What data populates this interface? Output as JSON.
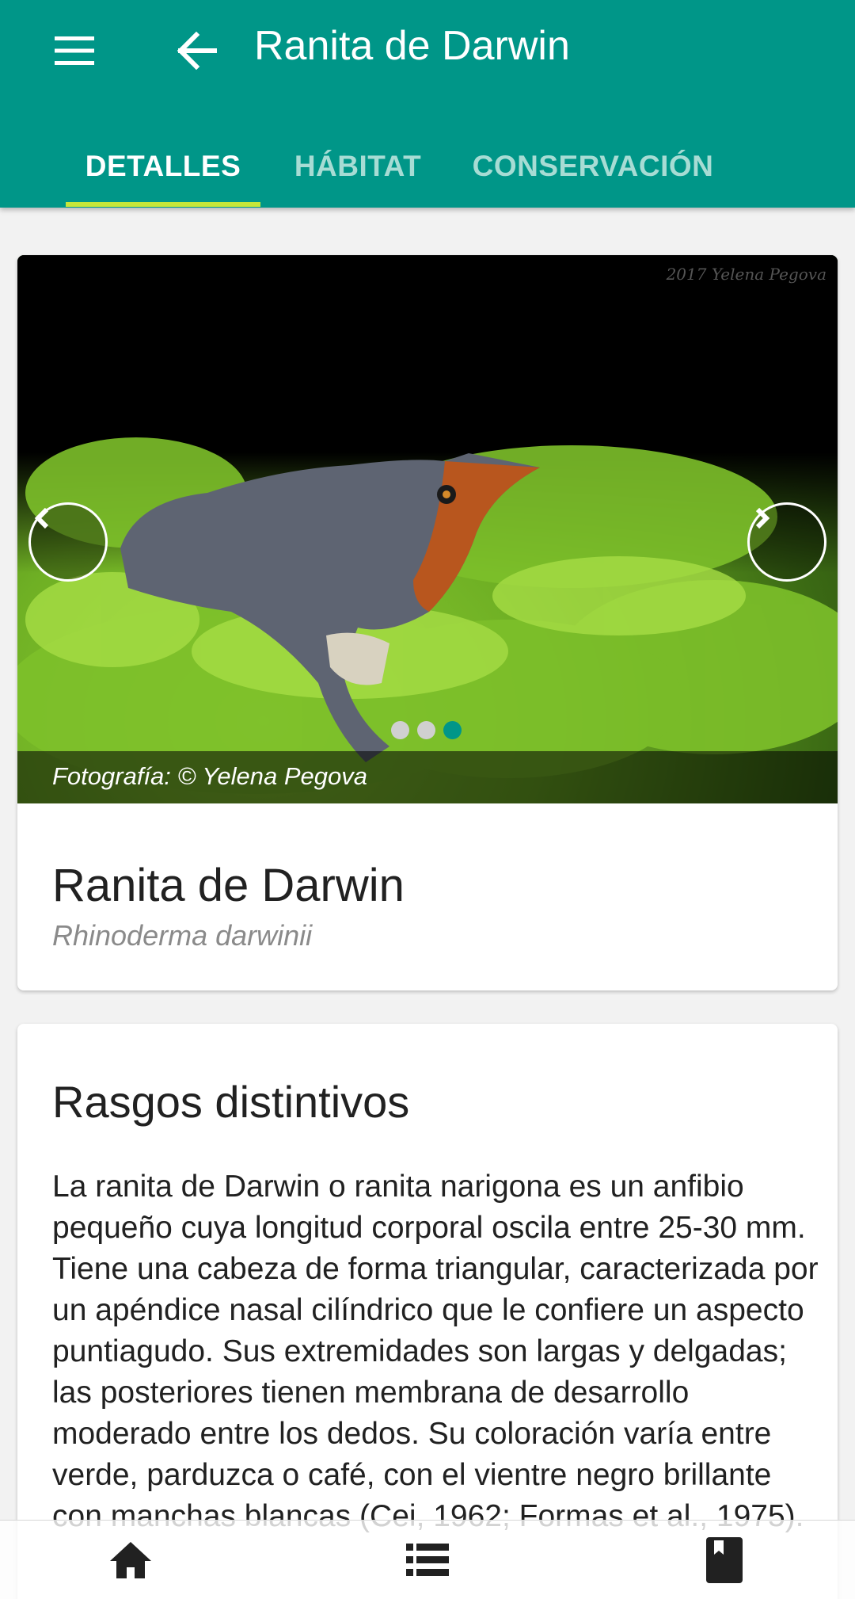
{
  "app_bar": {
    "title": "Ranita de Darwin",
    "menu_icon": "menu-icon",
    "back_icon": "arrow-back-icon",
    "background_color": "#009688"
  },
  "tabs": [
    {
      "label": "DETALLES",
      "active": true
    },
    {
      "label": "HÁBITAT",
      "active": false
    },
    {
      "label": "CONSERVACIÓN",
      "active": false
    }
  ],
  "tab_indicator_color": "#c6e63a",
  "gallery": {
    "watermark": "2017 Yelena Pegova",
    "caption": "Fotografía: © Yelena Pegova",
    "slide_count": 3,
    "active_slide": 3,
    "prev_icon": "chevron-left-icon",
    "next_icon": "chevron-right-icon",
    "active_dot_color": "#009688"
  },
  "species": {
    "common_name": "Ranita de Darwin",
    "scientific_name": "Rhinoderma darwinii"
  },
  "traits": {
    "title": "Rasgos distintivos",
    "body": "La ranita de Darwin o ranita narigona es un anfibio pequeño cuya longitud corporal oscila entre 25-30 mm. Tiene una cabeza de forma triangular, caracterizada por un apéndice nasal cilíndrico que le confiere un aspecto puntiagudo. Sus extremidades son largas y delgadas; las posteriores tienen membrana de desarrollo moderado entre los dedos. Su coloración varía entre verde, parduzca o café, con el vientre negro brillante con manchas blancas (Cei, 1962; Formas et al., 1975)."
  },
  "bottom_nav": [
    {
      "icon": "home-icon"
    },
    {
      "icon": "list-icon"
    },
    {
      "icon": "book-icon"
    }
  ]
}
